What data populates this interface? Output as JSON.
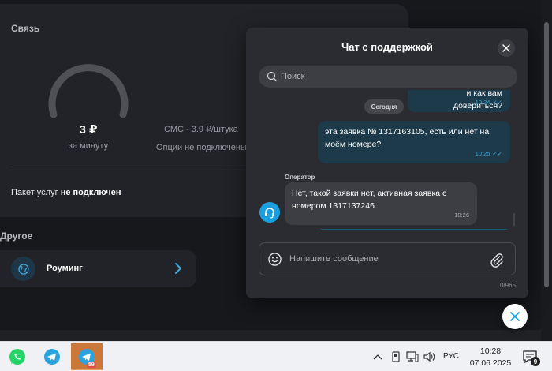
{
  "connection": {
    "title": "Связь",
    "price": "3 ₽",
    "price_unit": "за минуту",
    "sms": "СМС - 3.9 ₽/штука",
    "options": "Опции не подключены",
    "package_label": "Пакет услуг",
    "package_status": "не подключен"
  },
  "other": {
    "title": "Другое",
    "roaming": "Роуминг"
  },
  "chat": {
    "title": "Чат с поддержкой",
    "search_placeholder": "Поиск",
    "date_chip": "Сегодня",
    "messages": [
      {
        "type": "out",
        "text": "и как вам довериться?",
        "time": "10:24"
      },
      {
        "type": "out",
        "text": "эта заявка № 1317163105, есть или нет на моём номере?",
        "time": "10:25"
      },
      {
        "type": "in",
        "author": "Оператор",
        "text": "Нет, такой заявки нет, активная заявка с номером 1317137246",
        "time": "10:26"
      }
    ],
    "composer_placeholder": "Напишите сообщение",
    "char_counter": "0/965"
  },
  "taskbar": {
    "apps": [
      {
        "name": "WhatsApp",
        "icon": "whatsapp-icon"
      },
      {
        "name": "Telegram",
        "icon": "telegram-icon"
      },
      {
        "name": "Telegram",
        "icon": "telegram-icon",
        "badge": "59",
        "active": true
      }
    ],
    "language": "РУС",
    "time": "10:28",
    "date": "07.06.2025",
    "notifications": "9"
  },
  "colors": {
    "background": "#17181c",
    "card": "#222328",
    "accent": "#1aa0e0",
    "outgoing_bubble": "#1d3a4a"
  }
}
